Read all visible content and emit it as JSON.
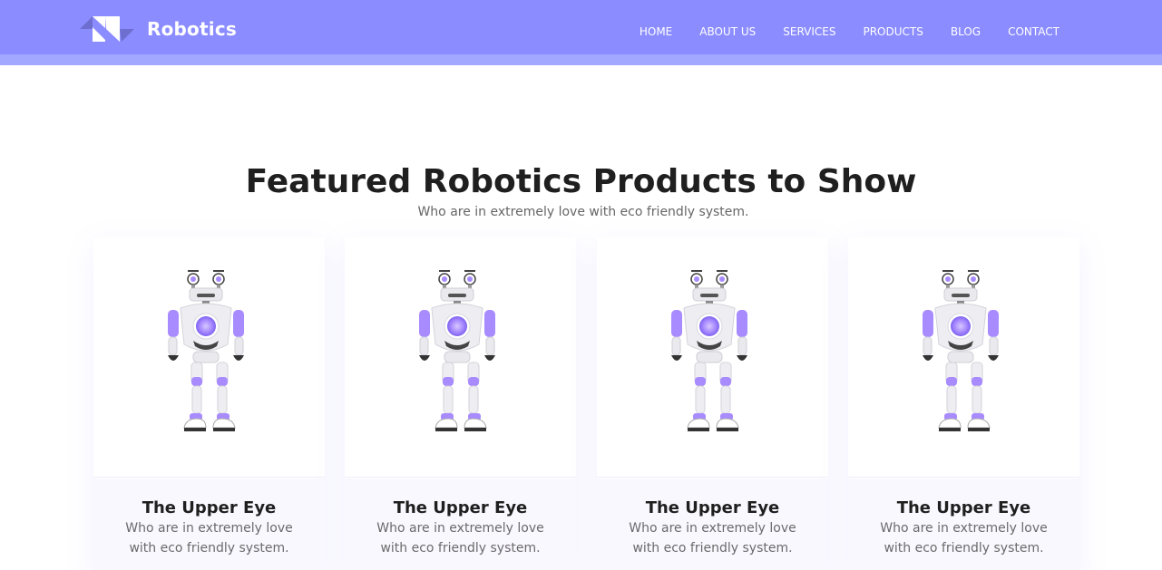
{
  "brand": {
    "name": "Robotics"
  },
  "nav": {
    "items": [
      "HOME",
      "ABOUT US",
      "SERVICES",
      "PRODUCTS",
      "BLOG",
      "CONTACT"
    ]
  },
  "section": {
    "title": "Featured Robotics Products to Show",
    "subtitle": "Who are in extremely love with eco friendly system."
  },
  "products": [
    {
      "title": "The Upper Eye",
      "description": "Who are in extremely love with eco friendly system."
    },
    {
      "title": "The Upper Eye",
      "description": "Who are in extremely love with eco friendly system."
    },
    {
      "title": "The Upper Eye",
      "description": "Who are in extremely love with eco friendly system."
    },
    {
      "title": "The Upper Eye",
      "description": "Who are in extremely love with eco friendly system."
    }
  ],
  "colors": {
    "header": "#8b8cff",
    "header_strip": "#a2a7ff",
    "robot_accent": "#a88bff",
    "robot_body": "#e9e9ee"
  },
  "icons": {
    "product_image": "robot-illustration"
  }
}
